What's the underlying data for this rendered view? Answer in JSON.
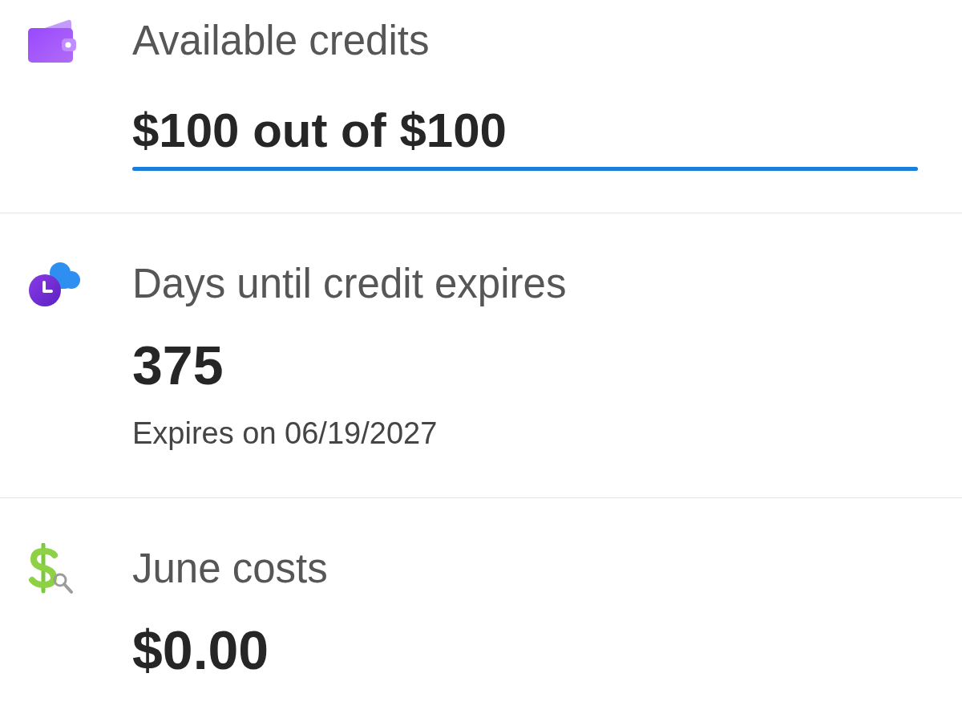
{
  "metrics": [
    {
      "kind": "meter",
      "label": "Available credits",
      "value": "$100 out of $100",
      "level": 1
    },
    {
      "kind": "stat",
      "label": "Days until credit expires",
      "value": "375",
      "note": "Expires on 06/19/2027"
    },
    {
      "kind": "stat",
      "label": "June costs",
      "value": "$0.00"
    }
  ]
}
